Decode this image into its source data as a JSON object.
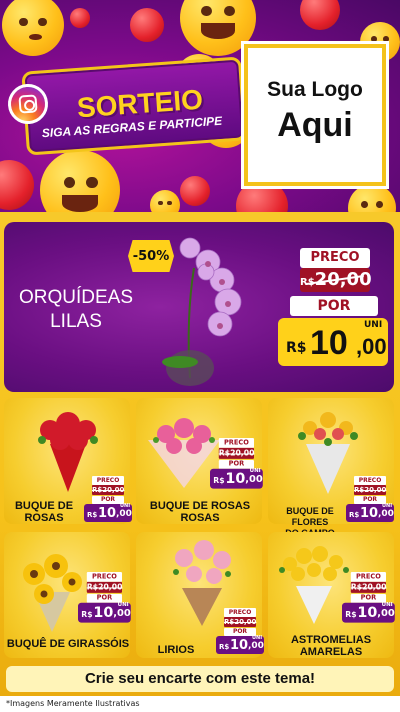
{
  "banner": {
    "title": "SORTEIO",
    "subtitle": "SIGA AS REGRAS E PARTICIPE",
    "logo_line1": "Sua Logo",
    "logo_line2": "Aqui"
  },
  "featured": {
    "name_line1": "ORQUÍDEAS",
    "name_line2": "LILAS",
    "discount": "-50%",
    "price_label": "PRECO",
    "old_currency": "R$",
    "old_price": "20,00",
    "por_label": "POR",
    "new_currency": "R$",
    "new_int": "10",
    "new_dec": ",00",
    "unit": "UNI"
  },
  "products": [
    {
      "name_line1": "BUQUE DE",
      "name_line2": "ROSAS",
      "price_label": "PRECO",
      "old_price": "R$20,00",
      "por_label": "POR",
      "currency": "R$",
      "int": "10",
      "dec": ",00",
      "unit": "UNI"
    },
    {
      "name_line1": "BUQUE DE ROSAS",
      "name_line2": "ROSAS",
      "price_label": "PRECO",
      "old_price": "R$20,00",
      "por_label": "POR",
      "currency": "R$",
      "int": "10",
      "dec": ",00",
      "unit": "UNI"
    },
    {
      "name_line1": "BUQUE DE FLORES",
      "name_line2": "DO CAMPO",
      "price_label": "PRECO",
      "old_price": "R$20,00",
      "por_label": "POR",
      "currency": "R$",
      "int": "10",
      "dec": ",00",
      "unit": "UNI"
    },
    {
      "name_line1": "BUQUÊ DE GIRASSÓIS",
      "name_line2": "",
      "price_label": "PRECO",
      "old_price": "R$20,00",
      "por_label": "POR",
      "currency": "R$",
      "int": "10",
      "dec": ",00",
      "unit": "UNI"
    },
    {
      "name_line1": "LIRIOS",
      "name_line2": "",
      "price_label": "PRECO",
      "old_price": "R$20,00",
      "por_label": "POR",
      "currency": "R$",
      "int": "10",
      "dec": ",00",
      "unit": "UNI"
    },
    {
      "name_line1": "ASTROMELIAS",
      "name_line2": "AMARELAS",
      "price_label": "PRECO",
      "old_price": "R$20,00",
      "por_label": "POR",
      "currency": "R$",
      "int": "10",
      "dec": ",00",
      "unit": "UNI"
    }
  ],
  "footer": {
    "cta": "Crie seu encarte com este tema!",
    "disclaimer": "*Imagens Meramente Ilustrativas"
  },
  "colors": {
    "purple": "#6a0f82",
    "yellow": "#f6c21b",
    "red": "#a01225"
  }
}
